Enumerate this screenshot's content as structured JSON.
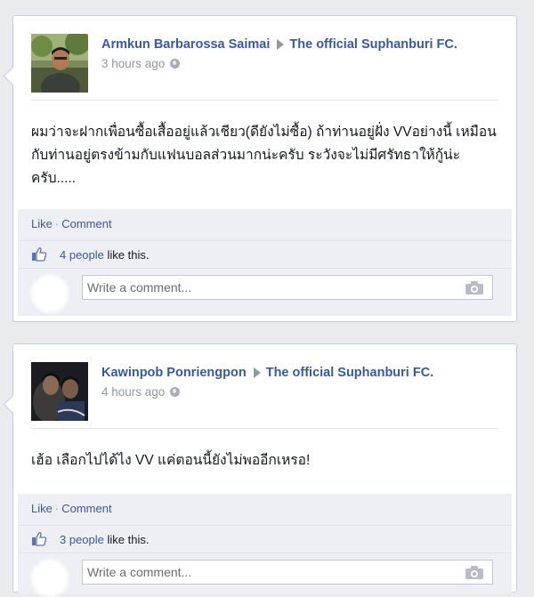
{
  "posts": [
    {
      "author": "Armkun Barbarossa Saimai",
      "target": "The official Suphanburi FC.",
      "time": "3 hours ago",
      "text": "ผมว่าจะฝากเพื่อนซื้อเสื้ออยู่แล้วเชียว(ดียังไม่ซื้อ) ถ้าท่านอยู่ฝั่ง VVอย่างนี้ เหมือนกับท่านอยู่ตรงข้ามกับแฟนบอลส่วนมากน่ะครับ ระวังจะไม่มีศรัทธาให้กู้น่ะครับ.....",
      "like_label": "Like",
      "comment_label": "Comment",
      "likes_count_text": "4 people",
      "likes_suffix": " like this.",
      "comment_placeholder": "Write a comment..."
    },
    {
      "author": "Kawinpob Ponriengpon",
      "target": "The official Suphanburi FC.",
      "time": "4 hours ago",
      "text": "เฮ้อ เลือกไปได้ไง VV แค่ตอนนี้ยังไม่พออีกเหรอ!",
      "like_label": "Like",
      "comment_label": "Comment",
      "likes_count_text": "3 people",
      "likes_suffix": " like this.",
      "comment_placeholder": "Write a comment..."
    }
  ],
  "icons": {
    "audience": "globe-icon",
    "like": "thumbs-up-icon",
    "attach": "camera-icon",
    "separator": "arrow-right-icon"
  },
  "colors": {
    "link": "#3b5998",
    "ufi_background": "#edeff4",
    "page_background": "#e9ebee"
  }
}
